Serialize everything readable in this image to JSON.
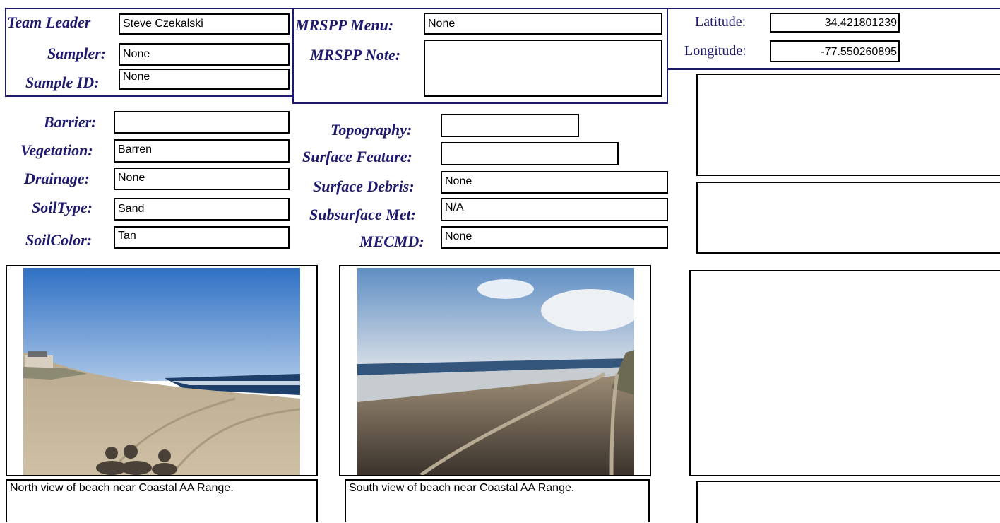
{
  "header": {
    "team_leader_label": "Team Leader",
    "team_leader_value": "Steve Czekalski",
    "sampler_label": "Sampler:",
    "sampler_value": "None",
    "sample_id_label": "Sample ID:",
    "sample_id_value": "None",
    "mrspp_menu_label": "MRSPP Menu:",
    "mrspp_menu_value": "None",
    "mrspp_note_label": "MRSPP Note:",
    "mrspp_note_value": "",
    "latitude_label": "Latitude:",
    "latitude_value": "34.421801239",
    "longitude_label": "Longitude:",
    "longitude_value": "-77.550260895"
  },
  "site": {
    "barrier_label": "Barrier:",
    "barrier_value": "",
    "vegetation_label": "Vegetation:",
    "vegetation_value": "Barren",
    "drainage_label": "Drainage:",
    "drainage_value": "None",
    "soiltype_label": "SoilType:",
    "soiltype_value": "Sand",
    "soilcolor_label": "SoilColor:",
    "soilcolor_value": "Tan",
    "topography_label": "Topography:",
    "topography_value": "",
    "surface_feature_label": "Surface Feature:",
    "surface_feature_value": "",
    "surface_debris_label": "Surface Debris:",
    "surface_debris_value": "None",
    "subsurface_met_label": "Subsurface Met:",
    "subsurface_met_value": "N/A",
    "mecmd_label": "MECMD:",
    "mecmd_value": "None"
  },
  "photos": [
    {
      "caption": "North view of beach near Coastal AA Range."
    },
    {
      "caption": "South view of beach near Coastal AA Range."
    }
  ],
  "colors": {
    "label_navy": "#1e1a6e",
    "field_border": "#000000"
  }
}
